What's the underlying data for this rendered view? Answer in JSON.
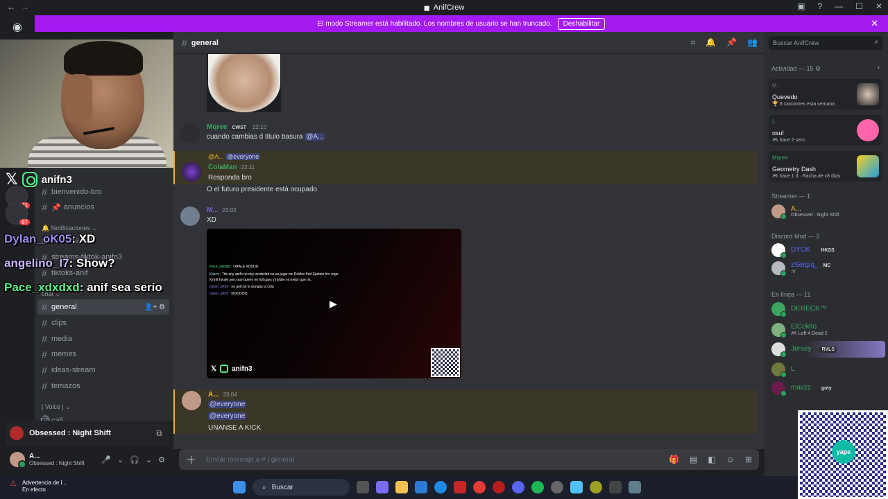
{
  "titlebar": {
    "title": "AnifCrew"
  },
  "banner": {
    "text": "El modo Streamer está habilitado. Los nombres de usuario se han truncado.",
    "button": "Deshabilitar"
  },
  "stream": {
    "handle": "anifn3",
    "overlay": [
      {
        "name": "Dylan_oK05",
        "text": ": XD"
      },
      {
        "name": "angelino_l7",
        "text": ": Show?"
      },
      {
        "name": "Pace_xdxdxd",
        "text": ": anif sea serio"
      }
    ]
  },
  "badges": [
    {
      "count": "11"
    },
    {
      "count": "67"
    }
  ],
  "sidebar": {
    "bienvenido": "bienvenido-bro",
    "anuncios": "anuncios",
    "notif_cat": "Notificaciones",
    "streams_kick": "streams-kick",
    "streams_tiktok": "streams-tiktok-anifn3",
    "tiktoks": "tiktoks-anif",
    "chat_cat": "chat",
    "general": "general",
    "clips": "clips",
    "media": "media",
    "memes": "memes",
    "ideas": "ideas-stream",
    "temazos": "temazos",
    "voice_cat": "Voice",
    "call": "call"
  },
  "nowplaying": {
    "text": "Obsessed : Night Shift"
  },
  "user": {
    "name": "A...",
    "status": "Obsessed : Night Shift"
  },
  "chat": {
    "channel": "general",
    "messages": {
      "m1": {
        "author": "Mqree",
        "tag": "CWST",
        "time": "22:10",
        "text": "cuando cambias d titulo basura",
        "mention": "@A..."
      },
      "m2": {
        "reply_user": "@A...",
        "reply_mention": "@everyone",
        "author": "ColaMan",
        "time": "22:11",
        "line1": "Responda bro",
        "line2": "O el futuro presidente está ocupado"
      },
      "m3": {
        "author": "M...",
        "time": "23:02",
        "text": "XD"
      },
      "m4": {
        "author": "A...",
        "time": "23:04",
        "mention1": "@everyone",
        "mention2": "@everyone",
        "text": "UNANSE A KICK"
      }
    },
    "video": {
      "lines": [
        {
          "name": "Pace_xdxdxd",
          "text": " : ORALE XDDDD"
        },
        {
          "name": "Kiiaco",
          "text": " : Ttts any anifn no doy verdedad no se jugar mc Roblox fnaf Epstein friv cogo"
        },
        {
          "name": "",
          "text": "fortnit hytale pero soy bueno en full gays y hytale es mejor que mc"
        },
        {
          "name": "Dylan_oK05",
          "text": " : no anif,no te pongas la cola"
        },
        {
          "name": "Dylan_oK05",
          "text": " : NOOOOO"
        }
      ],
      "handle": "anifn3"
    },
    "composer_placeholder": "Enviar mensaje a #  | general"
  },
  "members": {
    "search": "Buscar AnifCrew",
    "activity_header": "Actividad — 15",
    "activities": [
      {
        "top": "M...",
        "title": "Quevedo",
        "sub": "3 canciones esta semana"
      },
      {
        "top": "L",
        "title": "osu!",
        "sub": "hace 2 sem."
      },
      {
        "top": "Mqree",
        "title": "Geometry Dash",
        "sub": "hace 1 d  ·  Racha de x8 días"
      }
    ],
    "streamer_header": "Streamer — 1",
    "streamer": {
      "name": "A...",
      "sub": "Obsessed : Night Shift"
    },
    "mod_header": "Discord Mod — 2",
    "mods": [
      {
        "name": "DYOK",
        "tag": "HKSS"
      },
      {
        "name": "zSergiq_",
        "tag": "MC",
        "sub": ":V"
      }
    ],
    "online_header": "En línea — 11",
    "online": [
      {
        "name": "DERECK™",
        "sub": ""
      },
      {
        "name": "ElCokito",
        "sub": "Left 4 Dead 2"
      },
      {
        "name": "Jersey",
        "tag": "RVLS",
        "sub": ""
      },
      {
        "name": "L",
        "sub": ""
      },
      {
        "name": "mavzz",
        "tag": "goty",
        "sub": ""
      }
    ]
  },
  "taskbar": {
    "warn_title": "Advertencia de l...",
    "warn_sub": "En efecto",
    "search": "Buscar"
  },
  "qr": {
    "label": "yape"
  },
  "colors": {
    "accent": "#a31bf0",
    "mention": "#3c4270",
    "online": "#23a55a"
  }
}
